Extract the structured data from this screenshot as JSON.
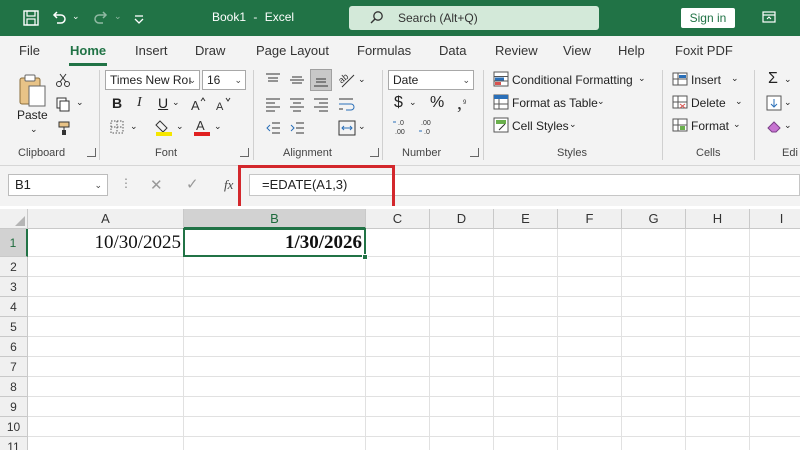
{
  "titlebar": {
    "document": "Book1",
    "separator": "-",
    "app": "Excel",
    "search_placeholder": "Search (Alt+Q)",
    "signin_label": "Sign in",
    "accent": "#217346"
  },
  "tabs": [
    {
      "label": "File"
    },
    {
      "label": "Home"
    },
    {
      "label": "Insert"
    },
    {
      "label": "Draw"
    },
    {
      "label": "Page Layout"
    },
    {
      "label": "Formulas"
    },
    {
      "label": "Data"
    },
    {
      "label": "Review"
    },
    {
      "label": "View"
    },
    {
      "label": "Help"
    },
    {
      "label": "Foxit PDF"
    }
  ],
  "ribbon": {
    "clipboard": {
      "paste_label": "Paste",
      "group_label": "Clipboard"
    },
    "font": {
      "font_name": "Times New Roı",
      "font_size": "16",
      "group_label": "Font"
    },
    "alignment": {
      "group_label": "Alignment"
    },
    "number": {
      "format": "Date",
      "group_label": "Number"
    },
    "styles": {
      "conditional_formatting": "Conditional Formatting",
      "format_as_table": "Format as Table",
      "cell_styles": "Cell Styles",
      "group_label": "Styles"
    },
    "cells": {
      "insert": "Insert",
      "delete": "Delete",
      "format": "Format",
      "group_label": "Cells"
    },
    "editing": {
      "group_label": "Edi"
    }
  },
  "formula_bar": {
    "name_box": "B1",
    "fx_label": "fx",
    "formula": "=EDATE(A1,3)"
  },
  "grid": {
    "columns": [
      "A",
      "B",
      "C",
      "D",
      "E",
      "F",
      "G",
      "H",
      "I"
    ],
    "rows": [
      "1",
      "2",
      "3",
      "4",
      "5",
      "6",
      "7",
      "8",
      "9",
      "10",
      "11"
    ],
    "cells": {
      "A1": "10/30/2025",
      "B1": "1/30/2026"
    },
    "selected_cell": "B1",
    "selection_color": "#217346"
  }
}
